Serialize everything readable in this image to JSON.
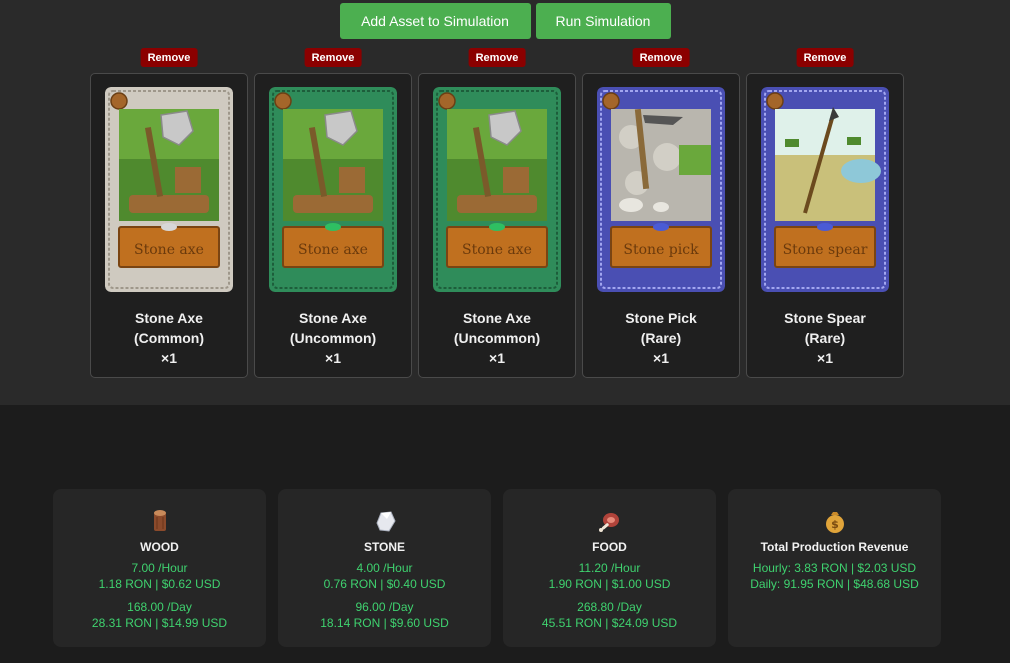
{
  "actions": {
    "add_label": "Add Asset to Simulation",
    "run_label": "Run Simulation"
  },
  "cards": [
    {
      "remove_label": "Remove",
      "name": "Stone Axe",
      "rarity": "(Common)",
      "qty": "×1",
      "art_label": "Stone axe",
      "frame_color": "#cfcac0"
    },
    {
      "remove_label": "Remove",
      "name": "Stone Axe",
      "rarity": "(Uncommon)",
      "qty": "×1",
      "art_label": "Stone axe",
      "frame_color": "#2f8c5a"
    },
    {
      "remove_label": "Remove",
      "name": "Stone Axe",
      "rarity": "(Uncommon)",
      "qty": "×1",
      "art_label": "Stone axe",
      "frame_color": "#2f8c5a"
    },
    {
      "remove_label": "Remove",
      "name": "Stone Pick",
      "rarity": "(Rare)",
      "qty": "×1",
      "art_label": "Stone pick",
      "frame_color": "#4a4fb3"
    },
    {
      "remove_label": "Remove",
      "name": "Stone Spear",
      "rarity": "(Rare)",
      "qty": "×1",
      "art_label": "Stone spear",
      "frame_color": "#4a4fb3"
    }
  ],
  "stats": {
    "wood": {
      "icon": "wood-icon",
      "title": "WOOD",
      "hourly_rate": "7.00 /Hour",
      "hourly_value": "1.18 RON | $0.62 USD",
      "daily_rate": "168.00 /Day",
      "daily_value": "28.31 RON | $14.99 USD"
    },
    "stone": {
      "icon": "stone-icon",
      "title": "STONE",
      "hourly_rate": "4.00 /Hour",
      "hourly_value": "0.76 RON | $0.40 USD",
      "daily_rate": "96.00 /Day",
      "daily_value": "18.14 RON | $9.60 USD"
    },
    "food": {
      "icon": "food-icon",
      "title": "FOOD",
      "hourly_rate": "11.20 /Hour",
      "hourly_value": "1.90 RON | $1.00 USD",
      "daily_rate": "268.80 /Day",
      "daily_value": "45.51 RON | $24.09 USD"
    },
    "revenue": {
      "icon": "money-bag-icon",
      "title": "Total Production Revenue",
      "hourly": "Hourly: 3.83 RON | $2.03 USD",
      "daily": "Daily: 91.95 RON | $48.68 USD"
    }
  },
  "colors": {
    "accent_green": "#4caf50",
    "remove_red": "#8b0000",
    "value_green": "#3fd26f"
  }
}
